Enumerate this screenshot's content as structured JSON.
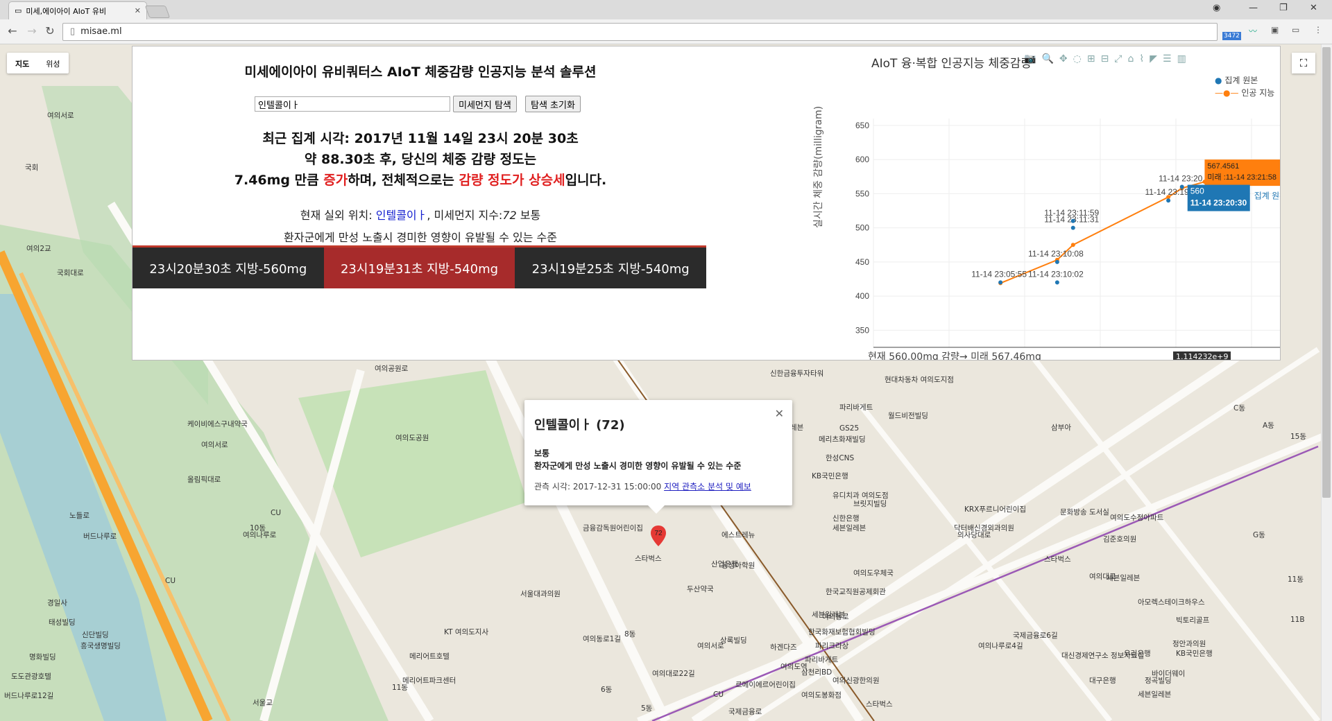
{
  "browser": {
    "tab_title": "미세,에이아이 AIoT 유비",
    "url": "misae.ml",
    "ext_badge": "3472"
  },
  "map": {
    "type_map": "지도",
    "type_satellite": "위성",
    "labels": [
      "국회",
      "여의서로",
      "여의2교",
      "국회대로",
      "여의공원로",
      "여의서로",
      "올림픽대로",
      "케이비에스구내약국",
      "여의도공원",
      "신한금융투자타워",
      "현대차동차 여의도지점",
      "파리바게트",
      "월드비전빌딩",
      "세븐일레븐",
      "메리츠화재빌딩",
      "GS25",
      "신용양조컨빌딩",
      "한성CNS",
      "KB국민은행",
      "유디치과 여의도점",
      "브릿지빌딩",
      "신한은행",
      "세븐일레븐",
      "닥터배신경외과의원",
      "KRX푸르니어린이집",
      "문화방송 도서실",
      "여의도수정아파트",
      "김준호의원",
      "스타벅스",
      "세븐일레븐",
      "아모렉스테이크하우스",
      "빅토리골프",
      "정안과의원",
      "KB국민은행",
      "우리은행",
      "바이더웨이",
      "정곡빌딩",
      "세븐일레븐",
      "대구은행",
      "대신경제연구소 정보자료실",
      "국제금융로6길",
      "여의나루로4길",
      "여의도우체국",
      "한국교직원공제회관",
      "세븐일레븐",
      "한국화재보험협회빌딩",
      "파리크라상",
      "파리바게트",
      "삼천리BD",
      "여의신광한의원",
      "여의도봉화점",
      "스타벅스",
      "동성아학원",
      "에스트레뉴",
      "산업은행",
      "금융감독원어린이집",
      "스타벅스",
      "두산약국",
      "서울대과의원",
      "KT 여의도지사",
      "메리어트호텔",
      "메리어트파크센터",
      "여의동로1길",
      "여의대로22길",
      "르메이에르어린이집",
      "하겐다즈",
      "여의도역",
      "서울교",
      "태성빌딩",
      "경일사",
      "명화빌딩",
      "신단빌딩",
      "흥국생명빌딩",
      "상록빌딩",
      "도도관광호텔",
      "버드나루로12길",
      "버드나루로",
      "노들로",
      "CU",
      "CU",
      "CU",
      "여의나루로",
      "국제금융로",
      "의사당대로",
      "여의대로",
      "여의동로",
      "여의서로",
      "11동",
      "10동",
      "8동",
      "6동",
      "5동",
      "삼부아",
      "C동",
      "A동",
      "G동",
      "11동",
      "11B",
      "15동"
    ]
  },
  "panel": {
    "title": "미세에이아이 유비쿼터스 AIoT 체중감량 인공지능 분석 솔루션",
    "search_value": "인텔콜이ㅏ",
    "search_button": "미세먼지 탐색",
    "reset_button": "탐색 초기화",
    "summary_line1": "최근 집계 시각: 2017년 11월 14일 23시 20분 30초",
    "summary_line2": "약 88.30초 후, 당신의 체중 감량 정도는",
    "summary_line3_pre": "7.46mg 만큼 ",
    "summary_line3_red1": "증가",
    "summary_line3_mid": "하며, 전체적으로는 ",
    "summary_line3_red2": "감량 정도가 상승세",
    "summary_line3_post": "입니다.",
    "loc_pre": "현재 실외 위치: ",
    "loc_name": "인텔콜이ㅏ",
    "loc_mid": ", 미세먼지 지수:",
    "loc_index": "72",
    "loc_grade": " 보통",
    "loc_desc": "환자군에게 만성 노출시 경미한 영향이 유발될 수 있는 수준",
    "history": [
      "23시20분30초 지방-560mg",
      "23시19분31초 지방-540mg",
      "23시19분25초 지방-540mg"
    ]
  },
  "chart_data": {
    "type": "scatter",
    "title": "AIoT 융·복합 인공지능 체중감량",
    "ylabel": "실시간 체중 감량(milligram)",
    "xlabel": "현재 560.00mg 감량→ 미래 567.46mg",
    "ylim": [
      325,
      660
    ],
    "yticks": [
      350,
      400,
      450,
      500,
      550,
      600,
      650
    ],
    "x_range": [
      0,
      1000
    ],
    "x_tag": "1.114232e+9",
    "series": [
      {
        "name": "집계 원본",
        "color": "#1f77b4",
        "points": [
          {
            "x": 280,
            "y": 420,
            "label": "11-14 23:05:55"
          },
          {
            "x": 405,
            "y": 420,
            "label": "11-14 23:10:02"
          },
          {
            "x": 405,
            "y": 450,
            "label": "11-14 23:10:08"
          },
          {
            "x": 440,
            "y": 500,
            "label": "11-14 23:11:31"
          },
          {
            "x": 440,
            "y": 510,
            "label": "11-14 23:11:59"
          },
          {
            "x": 650,
            "y": 540,
            "label": "11-14 23:19"
          },
          {
            "x": 680,
            "y": 560,
            "label": "11-14 23:20"
          }
        ]
      },
      {
        "name": "인공 지능",
        "color": "#ff7f0e",
        "points": [
          {
            "x": 280,
            "y": 419,
            "label": "11-14 23:05:55"
          },
          {
            "x": 405,
            "y": 453,
            "label": "11-14 23:10:08"
          },
          {
            "x": 440,
            "y": 475,
            "label": ""
          },
          {
            "x": 650,
            "y": 545,
            "label": ""
          },
          {
            "x": 680,
            "y": 558,
            "label": ""
          },
          {
            "x": 730,
            "y": 567.4561,
            "label": ""
          }
        ]
      }
    ],
    "hover_orange": {
      "value": "567.4561",
      "time": "미래 :11-14 23:21:58",
      "name": "인공 지능"
    },
    "hover_blue": {
      "value": "560",
      "time": "11-14 23:20:30",
      "name": "집계 원본"
    }
  },
  "popup": {
    "title": "인텔콜이ㅏ (72)",
    "grade": "보통",
    "desc": "환자군에게 만성 노출시 경미한 영향이 유발될 수 있는 수준",
    "time_pre": "관측 시각: 2017-12-31 15:00:00",
    "link": "지역 관측소 분석 및 예보",
    "marker_value": "72"
  }
}
